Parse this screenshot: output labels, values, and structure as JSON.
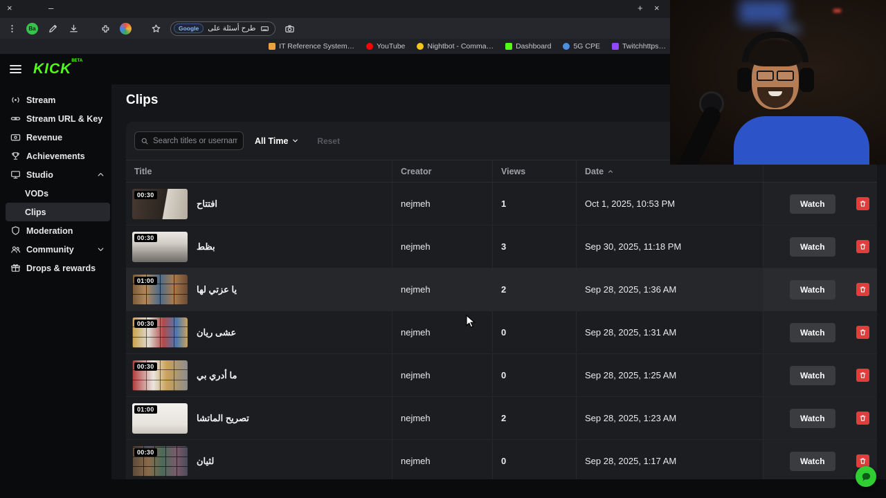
{
  "browser": {
    "window": {
      "close": "×",
      "minimize": "–",
      "new_tab": "+",
      "tab_close": "×"
    },
    "toolbar": {
      "avatar_badge": "Ba",
      "url_badge": "Google",
      "url_text": "طرح أسئلة على"
    },
    "bookmarks": [
      {
        "label": "IT Reference System…",
        "color": "#e8a33d"
      },
      {
        "label": "YouTube",
        "color": "#ff0000"
      },
      {
        "label": "Nightbot - Comma…",
        "color": "#f5c518"
      },
      {
        "label": "Dashboard",
        "color": "#53fc18"
      },
      {
        "label": "5G CPE",
        "color": "#4a90e2"
      },
      {
        "label": "Twitchhttps…",
        "color": "#9146ff"
      }
    ]
  },
  "app": {
    "logo": "KICK",
    "beta": "BETA",
    "accent_color": "#53fc18"
  },
  "sidebar": {
    "items": [
      {
        "label": "Stream"
      },
      {
        "label": "Stream URL & Key"
      },
      {
        "label": "Revenue"
      },
      {
        "label": "Achievements"
      },
      {
        "label": "Studio"
      },
      {
        "label": "VODs"
      },
      {
        "label": "Clips"
      },
      {
        "label": "Moderation"
      },
      {
        "label": "Community"
      },
      {
        "label": "Drops & rewards"
      }
    ],
    "selected": "Clips"
  },
  "main": {
    "title": "Clips",
    "search_placeholder": "Search titles or usernames",
    "time_filter": "All Time",
    "reset": "Reset",
    "watch": "Watch",
    "table": {
      "headers": {
        "title": "Title",
        "creator": "Creator",
        "views": "Views",
        "date": "Date"
      },
      "sorted_by": "Date",
      "rows": [
        {
          "duration": "00:30",
          "title": "افتتاح",
          "creator": "nejmeh",
          "views": "1",
          "date": "Oct 1, 2025, 10:53 PM"
        },
        {
          "duration": "00:30",
          "title": "بظط",
          "creator": "nejmeh",
          "views": "3",
          "date": "Sep 30, 2025, 11:18 PM"
        },
        {
          "duration": "01:00",
          "title": "يا عزتي لها",
          "creator": "nejmeh",
          "views": "2",
          "date": "Sep 28, 2025, 1:36 AM"
        },
        {
          "duration": "00:30",
          "title": "عشى ريان",
          "creator": "nejmeh",
          "views": "0",
          "date": "Sep 28, 2025, 1:31 AM"
        },
        {
          "duration": "00:30",
          "title": "ما أدري بي",
          "creator": "nejmeh",
          "views": "0",
          "date": "Sep 28, 2025, 1:25 AM"
        },
        {
          "duration": "01:00",
          "title": "تصريح الماتشا",
          "creator": "nejmeh",
          "views": "2",
          "date": "Sep 28, 2025, 1:23 AM"
        },
        {
          "duration": "00:30",
          "title": "لثيان",
          "creator": "nejmeh",
          "views": "0",
          "date": "Sep 28, 2025, 1:17 AM"
        }
      ]
    }
  }
}
